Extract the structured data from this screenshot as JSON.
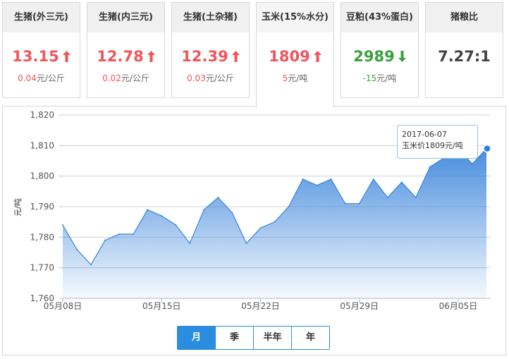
{
  "cards": [
    {
      "title": "生猪(外三元)",
      "value": "13.15",
      "trend": "up",
      "change": "0.04",
      "unit": "元/公斤"
    },
    {
      "title": "生猪(内三元)",
      "value": "12.78",
      "trend": "up",
      "change": "0.02",
      "unit": "元/公斤"
    },
    {
      "title": "生猪(土杂猪)",
      "value": "12.39",
      "trend": "up",
      "change": "0.03",
      "unit": "元/公斤"
    },
    {
      "title": "玉米(15%水分)",
      "value": "1809",
      "trend": "up",
      "change": "5",
      "unit": "元/吨"
    },
    {
      "title": "豆粕(43%蛋白)",
      "value": "2989",
      "trend": "down",
      "change": "-15",
      "unit": "元/吨"
    },
    {
      "title": "猪粮比",
      "value": "7.27:1",
      "trend": "none",
      "change": "",
      "unit": ""
    }
  ],
  "active_card": 3,
  "colors": {
    "up": "#f0555b",
    "down": "#3aa13a",
    "accent": "#2a8de0",
    "area": "#4a90e2"
  },
  "tooltip": {
    "date": "2017-06-07",
    "label": "玉米价1809元/吨"
  },
  "periods": [
    "月",
    "季",
    "半年",
    "年"
  ],
  "active_period": 0,
  "chart_data": {
    "type": "area",
    "ylabel": "元/吨",
    "ylim": [
      1760,
      1820
    ],
    "yticks": [
      1760,
      1770,
      1780,
      1790,
      1800,
      1810,
      1820
    ],
    "ytick_labels": [
      "1,760",
      "1,770",
      "1,780",
      "1,790",
      "1,800",
      "1,810",
      "1,820"
    ],
    "xtick_labels": [
      "05月08日",
      "05月15日",
      "05月22日",
      "05月29日",
      "06月05日"
    ],
    "xtick_index": [
      0,
      7,
      14,
      21,
      28
    ],
    "x": [
      "05-08",
      "05-09",
      "05-10",
      "05-11",
      "05-12",
      "05-13",
      "05-14",
      "05-15",
      "05-16",
      "05-17",
      "05-18",
      "05-19",
      "05-20",
      "05-21",
      "05-22",
      "05-23",
      "05-24",
      "05-25",
      "05-26",
      "05-27",
      "05-28",
      "05-29",
      "05-30",
      "05-31",
      "06-01",
      "06-02",
      "06-03",
      "06-04",
      "06-05",
      "06-06",
      "06-07"
    ],
    "values": [
      1784,
      1776,
      1771,
      1779,
      1781,
      1781,
      1789,
      1787,
      1784,
      1778,
      1789,
      1793,
      1788,
      1778,
      1783,
      1785,
      1790,
      1799,
      1797,
      1799,
      1791,
      1791,
      1799,
      1793,
      1798,
      1793,
      1803,
      1806,
      1809,
      1804,
      1809
    ],
    "grid": true,
    "highlight_index": 30
  }
}
